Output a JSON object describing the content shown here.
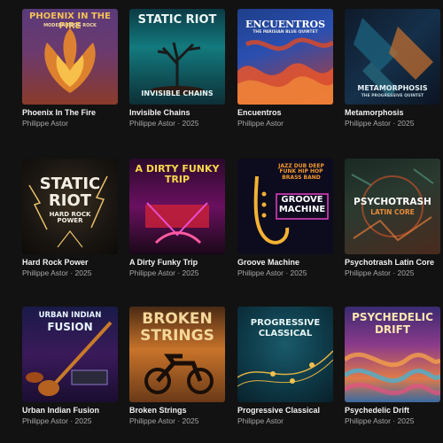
{
  "albums": [
    {
      "title": "Phoenix In The Fire",
      "subtitle": "Philippe Astor",
      "cover_line1": "PHOENIX IN THE FIRE",
      "cover_line2": "MODERN PROG ROCK",
      "cover_icon": "phoenix-art"
    },
    {
      "title": "Invisible Chains",
      "subtitle": "Philippe Astor · 2025",
      "cover_line1": "STATIC RIOT",
      "cover_line2": "INVISIBLE CHAINS",
      "cover_icon": "tree-art"
    },
    {
      "title": "Encuentros",
      "subtitle": "Philippe Astor",
      "cover_line1": "ENCUENTROS",
      "cover_line2": "THE PARISIAN BLUE QUINTET",
      "cover_icon": "flame-wave-art"
    },
    {
      "title": "Metamorphosis",
      "subtitle": "Philippe Astor · 2025",
      "cover_line1": "METAMORPHOSIS",
      "cover_line2": "THE PROGRESSIVE QUINTET",
      "cover_icon": "geometric-art"
    },
    {
      "title": "Hard Rock Power",
      "subtitle": "Philippe Astor · 2025",
      "cover_line1": "STATIC RIOT",
      "cover_line2": "HARD ROCK POWER",
      "cover_icon": "lightning-art"
    },
    {
      "title": "A Dirty Funky Trip",
      "subtitle": "Philippe Astor · 2025",
      "cover_line1": "A DIRTY FUNKY TRIP",
      "cover_line2": "",
      "cover_icon": "guitar-art"
    },
    {
      "title": "Groove Machine",
      "subtitle": "Philippe Astor · 2025",
      "cover_line1": "GROOVE MACHINE",
      "cover_line2": "JAZZ  DUB  DEEP FUNK  HIP HOP  BRASS BAND",
      "cover_icon": "saxophone-art"
    },
    {
      "title": "Psychotrash Latin Core",
      "subtitle": "Philippe Astor · 2025",
      "cover_line1": "PSYCHOTRASH",
      "cover_line2": "LATIN CORE",
      "cover_icon": "abstract-art"
    },
    {
      "title": "Urban Indian Fusion",
      "subtitle": "Philippe Astor · 2025",
      "cover_line1": "URBAN INDIAN",
      "cover_line2": "FUSION",
      "cover_icon": "sitar-art"
    },
    {
      "title": "Broken Strings",
      "subtitle": "Philippe Astor · 2025",
      "cover_line1": "BROKEN",
      "cover_line2": "STRINGS",
      "cover_icon": "motorcycle-art"
    },
    {
      "title": "Progressive Classical",
      "subtitle": "Philippe Astor",
      "cover_line1": "PROGRESSIVE",
      "cover_line2": "CLASSICAL",
      "cover_icon": "music-notes-art"
    },
    {
      "title": "Psychedelic Drift",
      "subtitle": "Philippe Astor · 2025",
      "cover_line1": "PSYCHEDELIC",
      "cover_line2": "DRIFT",
      "cover_icon": "swirl-art"
    }
  ]
}
